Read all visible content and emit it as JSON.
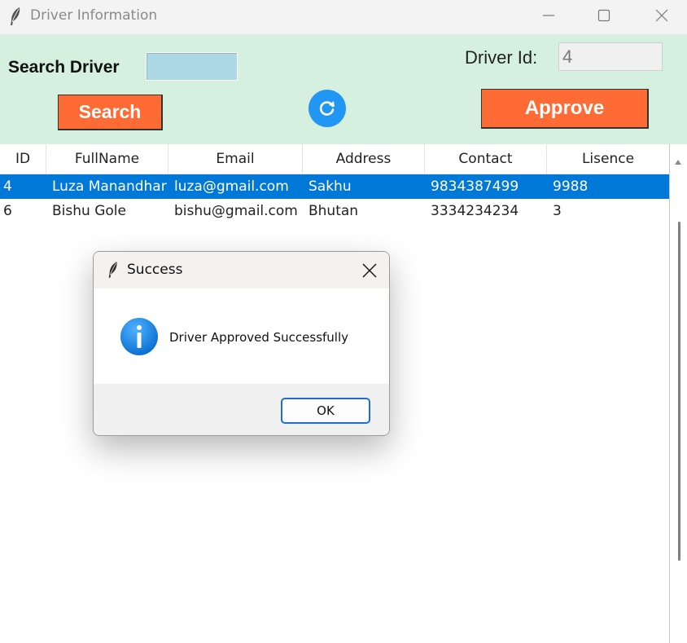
{
  "window": {
    "title": "Driver Information",
    "icons": {
      "app": "feather-icon",
      "minimize": "minimize-icon",
      "maximize": "maximize-icon",
      "close": "close-icon"
    }
  },
  "toolbar": {
    "search_label": "Search Driver",
    "search_value": "",
    "search_button": "Search",
    "refresh_icon": "refresh-icon",
    "driver_id_label": "Driver Id:",
    "driver_id_value": "4",
    "approve_button": "Approve",
    "colors": {
      "background": "#d5f0de",
      "button": "#ff6b35",
      "search_field": "#add8e6",
      "refresh": "#2196f3"
    }
  },
  "table": {
    "columns": [
      "ID",
      "FullName",
      "Email",
      "Address",
      "Contact",
      "Lisence"
    ],
    "rows": [
      {
        "selected": true,
        "cells": [
          "4",
          "Luza Manandhar",
          "luza@gmail.com",
          "Sakhu",
          "9834387499",
          "9988"
        ]
      },
      {
        "selected": false,
        "cells": [
          "6",
          "Bishu Gole",
          "bishu@gmail.com",
          "Bhutan",
          "3334234234",
          "3"
        ]
      }
    ],
    "selection_color": "#0078d7"
  },
  "dialog": {
    "title": "Success",
    "message": "Driver Approved Successfully",
    "ok_button": "OK",
    "icon": "info-icon"
  }
}
